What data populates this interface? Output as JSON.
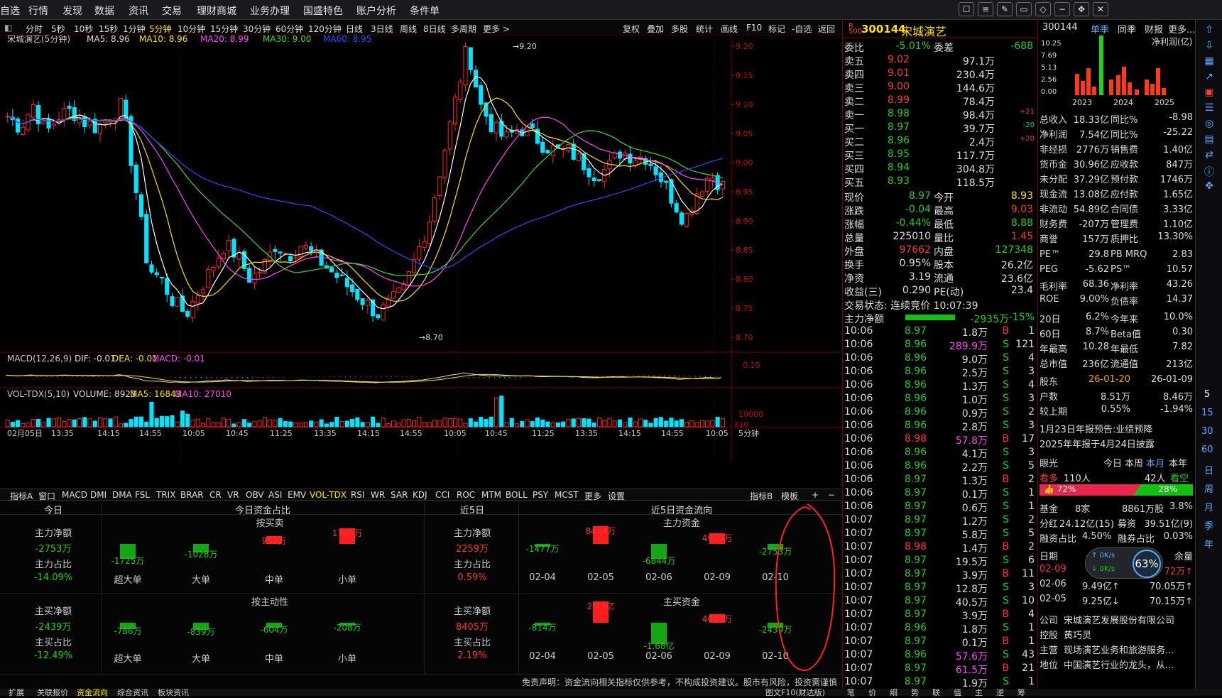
{
  "menu": {
    "items": [
      "自选",
      "行情",
      "发现",
      "数据",
      "资讯",
      "交易",
      "理财商城",
      "业务办理",
      "国盛特色",
      "账户分析",
      "条件单"
    ]
  },
  "periods": {
    "items": [
      "分时",
      "5秒",
      "10秒",
      "15秒",
      "1分钟",
      "5分钟",
      "10分钟",
      "15分钟",
      "30分钟",
      "60分钟",
      "120分钟",
      "日线",
      "3日线",
      "周线",
      "8日线",
      "多周期",
      "更多 >"
    ],
    "selected": "5分钟"
  },
  "chart_tools": [
    "复权",
    "叠加",
    "多股",
    "统计",
    "画线",
    "F10",
    "标记",
    "-自选",
    "返回"
  ],
  "chart_header": {
    "name": "宋城演艺(5分钟)",
    "ma5": "MA5: 8.96",
    "ma10": "MA10: 8.96",
    "ma20": "MA20: 8.99",
    "ma30": "MA30: 9.00",
    "ma60": "MA60: 8.95"
  },
  "price_axis": [
    "9.20",
    "9.15",
    "9.10",
    "9.05",
    "9.00",
    "8.95",
    "8.90",
    "8.85",
    "8.80",
    "8.75",
    "8.70"
  ],
  "annot": {
    "high": "9.20",
    "low": "8.70"
  },
  "macd": {
    "label": "MACD(12,26,9)",
    "dif": "DIF: -0.01",
    "dea": "DEA: -0.01",
    "macd": "MACD: -0.01",
    "axis": "0.10"
  },
  "vol": {
    "label": "VOL-TDX(5,10)",
    "volume": "VOLUME: 8923",
    "ma5": "MA5: 16843",
    "ma10": "MA10: 27010",
    "axis": "10000",
    "unit": "X10"
  },
  "time_axis": [
    "02月05日",
    "13:35",
    "14:15",
    "14:55",
    "10:05",
    "10:45",
    "11:25",
    "13:35",
    "14:15",
    "14:55",
    "10:05",
    "10:45",
    "11:25",
    "13:35",
    "14:15",
    "14:55",
    "10:05"
  ],
  "period_tag": "5分钟",
  "indicators": {
    "items": [
      "指标A",
      "窗口",
      "MACD",
      "DMI",
      "DMA",
      "FSL",
      "TRIX",
      "BRAR",
      "CR",
      "VR",
      "OBV",
      "ASI",
      "EMV",
      "VOL-TDX",
      "RSI",
      "WR",
      "SAR",
      "KDJ",
      "CCI",
      "ROC",
      "MTM",
      "BOLL",
      "PSY",
      "MCST",
      "更多",
      "设置"
    ],
    "selected": "VOL-TDX",
    "right": [
      "指标B",
      "模板",
      "+",
      "−"
    ]
  },
  "capital": {
    "today": "今日",
    "today_ratio": "今日资金占比",
    "last5": "近5日",
    "last5_flow": "近5日资金流向",
    "by_order": "按买卖",
    "by_active": "按主动性",
    "main_fund": "主力资金",
    "main_buy": "主买资金",
    "today_stats": [
      {
        "label": "主力净额",
        "value": "-2753万"
      },
      {
        "label": "主力占比",
        "value": "-14.09%"
      },
      {
        "label": "主买净额",
        "value": "-2439万"
      },
      {
        "label": "主买占比",
        "value": "-12.49%"
      }
    ],
    "last5_stats": [
      {
        "label": "主力净额",
        "value": "2259万"
      },
      {
        "label": "主力占比",
        "value": "0.59%"
      },
      {
        "label": "主买净额",
        "value": "8405万"
      },
      {
        "label": "主买占比",
        "value": "2.19%"
      }
    ],
    "sizes": [
      "超大单",
      "大单",
      "中单",
      "小单"
    ],
    "order_vals": [
      "-1725万",
      "-1028万",
      "957万",
      "1795万"
    ],
    "active_vals": [
      "-786万",
      "-839万",
      "-604万",
      "-208万"
    ],
    "dates": [
      "02-04",
      "02-05",
      "02-06",
      "02-09",
      "02-10"
    ],
    "main_vals": [
      "-1477万",
      "8414万",
      "-6844万",
      "4920万",
      "-2753万"
    ],
    "buy_vals": [
      "-814万",
      "2.44亿",
      "-1.68亿",
      "4003万",
      "-2439万"
    ],
    "disclaimer": "免责声明：资金流向相关指标仅供参考，不构成投资建议。股市有风险，投资需谨慎"
  },
  "bottom_tabs": [
    "扩展",
    "关联报价",
    "资金流向",
    "综合资讯",
    "板块资讯",
    "图文F10(财达版)"
  ],
  "quote": {
    "code": "300144",
    "name": "宋城演艺",
    "weibi": {
      "label": "委比",
      "value": "-5.01%",
      "label2": "委差",
      "value2": "-688"
    },
    "sell": [
      {
        "label": "卖五",
        "price": "9.02",
        "vol": "97.1万",
        "chg": ""
      },
      {
        "label": "卖四",
        "price": "9.01",
        "vol": "230.4万",
        "chg": ""
      },
      {
        "label": "卖三",
        "price": "9.00",
        "vol": "144.6万",
        "chg": ""
      },
      {
        "label": "卖二",
        "price": "8.99",
        "vol": "78.4万",
        "chg": ""
      },
      {
        "label": "卖一",
        "price": "8.98",
        "vol": "98.4万",
        "chg": "+21"
      }
    ],
    "buy": [
      {
        "label": "买一",
        "price": "8.97",
        "vol": "39.7万",
        "chg": "-20"
      },
      {
        "label": "买二",
        "price": "8.96",
        "vol": "2.4万",
        "chg": "+20"
      },
      {
        "label": "买三",
        "price": "8.95",
        "vol": "117.7万",
        "chg": ""
      },
      {
        "label": "买四",
        "price": "8.94",
        "vol": "304.8万",
        "chg": ""
      },
      {
        "label": "买五",
        "price": "8.93",
        "vol": "118.5万",
        "chg": ""
      }
    ],
    "stats": [
      {
        "l1": "现价",
        "v1": "8.97",
        "l2": "今开",
        "v2": "8.93"
      },
      {
        "l1": "涨跌",
        "v1": "-0.04",
        "l2": "最高",
        "v2": "9.03"
      },
      {
        "l1": "涨幅",
        "v1": "-0.44%",
        "l2": "最低",
        "v2": "8.88"
      },
      {
        "l1": "总量",
        "v1": "225010",
        "l2": "量比",
        "v2": "1.45"
      },
      {
        "l1": "外盘",
        "v1": "97662",
        "l2": "内盘",
        "v2": "127348"
      },
      {
        "l1": "换手",
        "v1": "0.95%",
        "l2": "股本",
        "v2": "26.2亿"
      },
      {
        "l1": "净资",
        "v1": "3.19",
        "l2": "流通",
        "v2": "23.6亿"
      },
      {
        "l1": "收益(三)",
        "v1": "0.290",
        "l2": "PE(动)",
        "v2": "23.4"
      }
    ],
    "status": "交易状态: 连续竞价 10:07:39",
    "main_net": {
      "label": "主力净额",
      "value": "-2935万",
      "pct": "-15%"
    },
    "ticks": [
      [
        "10:06",
        "8.97",
        "1.8万",
        "B",
        "1"
      ],
      [
        "10:06",
        "8.96",
        "289.9万",
        "S",
        "121"
      ],
      [
        "10:06",
        "8.96",
        "9.0万",
        "S",
        "4"
      ],
      [
        "10:06",
        "8.96",
        "2.5万",
        "S",
        "3"
      ],
      [
        "10:06",
        "8.96",
        "1.3万",
        "S",
        "4"
      ],
      [
        "10:06",
        "8.96",
        "1.0万",
        "S",
        "3"
      ],
      [
        "10:06",
        "8.96",
        "0.9万",
        "S",
        "2"
      ],
      [
        "10:06",
        "8.96",
        "2.8万",
        "S",
        "3"
      ],
      [
        "10:06",
        "8.98",
        "57.8万",
        "B",
        "17"
      ],
      [
        "10:06",
        "8.96",
        "4.1万",
        "S",
        "3"
      ],
      [
        "10:06",
        "8.96",
        "2.2万",
        "S",
        "5"
      ],
      [
        "10:06",
        "8.97",
        "1.3万",
        "B",
        "2"
      ],
      [
        "10:06",
        "8.97",
        "0.1万",
        "S",
        "1"
      ],
      [
        "10:06",
        "8.97",
        "0.6万",
        "S",
        "1"
      ],
      [
        "10:07",
        "8.97",
        "1.2万",
        "S",
        "2"
      ],
      [
        "10:07",
        "8.97",
        "5.8万",
        "S",
        "5"
      ],
      [
        "10:07",
        "8.98",
        "1.4万",
        "B",
        "2"
      ],
      [
        "10:07",
        "8.97",
        "19.5万",
        "S",
        "6"
      ],
      [
        "10:07",
        "8.97",
        "3.9万",
        "B",
        "11"
      ],
      [
        "10:07",
        "8.97",
        "12.8万",
        "S",
        "3"
      ],
      [
        "10:07",
        "8.97",
        "40.5万",
        "S",
        "10"
      ],
      [
        "10:07",
        "8.97",
        "3.9万",
        "B",
        "4"
      ],
      [
        "10:07",
        "8.96",
        "1.8万",
        "S",
        "1"
      ],
      [
        "10:07",
        "8.97",
        "0.1万",
        "B",
        "1"
      ],
      [
        "10:07",
        "8.96",
        "57.6万",
        "S",
        "43"
      ],
      [
        "10:07",
        "8.97",
        "61.5万",
        "B",
        "21"
      ],
      [
        "10:07",
        "8.97",
        "1.9万",
        "S",
        "1"
      ]
    ]
  },
  "fin": {
    "code": "300144",
    "tabs": [
      "单季",
      "同季",
      "财报",
      "更多..."
    ],
    "chart_title": "净利润(亿)",
    "yaxis": [
      "10.25",
      "7.69",
      "5.13",
      "2.56",
      "0.00"
    ],
    "years": [
      "2023",
      "2024",
      "2025"
    ],
    "rows": [
      {
        "l1": "总收入",
        "v1": "18.33亿",
        "l2": "同比%",
        "v2": "-8.98"
      },
      {
        "l1": "净利润",
        "v1": "7.54亿",
        "l2": "同比%",
        "v2": "-25.22"
      },
      {
        "l1": "非经损",
        "v1": "2776万",
        "l2": "销售费",
        "v2": "1.40亿"
      },
      {
        "l1": "货币金",
        "v1": "30.96亿",
        "l2": "应收款",
        "v2": "847万"
      },
      {
        "l1": "未分配",
        "v1": "37.29亿",
        "l2": "预付款",
        "v2": "1746万"
      },
      {
        "l1": "现金流",
        "v1": "13.08亿",
        "l2": "应付款",
        "v2": "1.65亿"
      },
      {
        "l1": "非流动",
        "v1": "54.89亿",
        "l2": "合同债",
        "v2": "3.33亿"
      },
      {
        "l1": "财务费",
        "v1": "-207万",
        "l2": "管理费",
        "v2": "1.10亿"
      },
      {
        "l1": "商誉",
        "v1": "157万",
        "l2": "质押比",
        "v2": "13.30%"
      }
    ],
    "rows2": [
      {
        "l1": "PE™",
        "v1": "29.8",
        "l2": "PB MRQ",
        "v2": "2.83"
      },
      {
        "l1": "PEG",
        "v1": "-5.62",
        "l2": "PS™",
        "v2": "10.57"
      },
      {
        "l1": "毛利率",
        "v1": "68.36",
        "l2": "净利率",
        "v2": "43.26"
      },
      {
        "l1": "ROE",
        "v1": "9.00%",
        "l2": "负债率",
        "v2": "14.37"
      }
    ],
    "rows3": [
      {
        "l1": "20日",
        "v1": "6.2%",
        "l2": "今年来",
        "v2": "10.0%"
      },
      {
        "l1": "60日",
        "v1": "8.7%",
        "l2": "Beta值",
        "v2": "0.30"
      },
      {
        "l1": "年最高",
        "v1": "10.28",
        "l2": "年最低",
        "v2": "7.82"
      },
      {
        "l1": "总市值",
        "v1": "236亿",
        "l2": "流通值",
        "v2": "213亿"
      }
    ],
    "holders": [
      {
        "l1": "股东",
        "v1": "26-01-20",
        "v2": "26-01-09"
      },
      {
        "l1": "户数",
        "v1": "8.51万",
        "v2": "8.46万"
      },
      {
        "l1": "较上期",
        "v1": "0.55%",
        "v2": "-1.94%"
      }
    ],
    "news1": "1月23日年报预告:业绩预降",
    "news2": "2025年年报于4月24日披露",
    "vision": {
      "label": "眼光",
      "tabs": [
        "今日",
        "本周",
        "本月",
        "本年"
      ],
      "bull": "看多",
      "bull_n": "110人",
      "bear_n": "42人",
      "bear": "看空",
      "bull_pct": "72%",
      "bear_pct": "28%"
    },
    "funds": {
      "l": "基金",
      "v1": "8家",
      "v2": "8861万股",
      "v3": "3.8%"
    },
    "div": {
      "l": "分红",
      "v1": "24.12亿(15)",
      "l2": "募资",
      "v2": "39.51亿(9)"
    },
    "margin": {
      "l": "融资占比",
      "v1": "4.50%",
      "l2": "融券占比",
      "v2": "0.03%"
    },
    "margin_tbl": {
      "h1": "日期",
      "h2": "余量",
      "rows": [
        {
          "d": "02-09",
          "v": "72万↑"
        },
        {
          "d": "02-06",
          "v": "9.49亿↑",
          "v2": "70.05万↑"
        },
        {
          "d": "02-05",
          "v": "9.25亿↓",
          "v2": "70.15万↑"
        }
      ]
    },
    "speed": {
      "pct": "63",
      "up": "0K/s",
      "down": "0K/s"
    },
    "company": {
      "l": "公司",
      "v": "宋城演艺发展股份有限公司"
    },
    "holder": {
      "l": "控股",
      "v": "黄巧灵"
    },
    "biz": {
      "l": "主营",
      "v": "现场演艺业务和旅游服务..."
    },
    "pos": {
      "l": "地位",
      "v": "中国演艺行业的龙头，从..."
    }
  },
  "side_tags": [
    "5",
    "15",
    "30",
    "60",
    "日",
    "周",
    "月",
    "季",
    "年"
  ],
  "bottom_right_tabs": [
    "笔",
    "价",
    "细",
    "势",
    "联",
    "值",
    "主",
    "逆",
    "筹"
  ]
}
